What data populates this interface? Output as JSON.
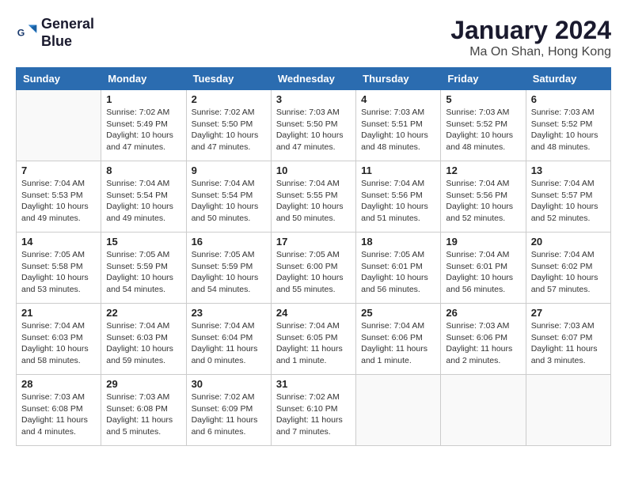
{
  "logo": {
    "line1": "General",
    "line2": "Blue"
  },
  "title": {
    "month_year": "January 2024",
    "location": "Ma On Shan, Hong Kong"
  },
  "weekdays": [
    "Sunday",
    "Monday",
    "Tuesday",
    "Wednesday",
    "Thursday",
    "Friday",
    "Saturday"
  ],
  "weeks": [
    [
      {
        "day": "",
        "info": ""
      },
      {
        "day": "1",
        "info": "Sunrise: 7:02 AM\nSunset: 5:49 PM\nDaylight: 10 hours\nand 47 minutes."
      },
      {
        "day": "2",
        "info": "Sunrise: 7:02 AM\nSunset: 5:50 PM\nDaylight: 10 hours\nand 47 minutes."
      },
      {
        "day": "3",
        "info": "Sunrise: 7:03 AM\nSunset: 5:50 PM\nDaylight: 10 hours\nand 47 minutes."
      },
      {
        "day": "4",
        "info": "Sunrise: 7:03 AM\nSunset: 5:51 PM\nDaylight: 10 hours\nand 48 minutes."
      },
      {
        "day": "5",
        "info": "Sunrise: 7:03 AM\nSunset: 5:52 PM\nDaylight: 10 hours\nand 48 minutes."
      },
      {
        "day": "6",
        "info": "Sunrise: 7:03 AM\nSunset: 5:52 PM\nDaylight: 10 hours\nand 48 minutes."
      }
    ],
    [
      {
        "day": "7",
        "info": "Sunrise: 7:04 AM\nSunset: 5:53 PM\nDaylight: 10 hours\nand 49 minutes."
      },
      {
        "day": "8",
        "info": "Sunrise: 7:04 AM\nSunset: 5:54 PM\nDaylight: 10 hours\nand 49 minutes."
      },
      {
        "day": "9",
        "info": "Sunrise: 7:04 AM\nSunset: 5:54 PM\nDaylight: 10 hours\nand 50 minutes."
      },
      {
        "day": "10",
        "info": "Sunrise: 7:04 AM\nSunset: 5:55 PM\nDaylight: 10 hours\nand 50 minutes."
      },
      {
        "day": "11",
        "info": "Sunrise: 7:04 AM\nSunset: 5:56 PM\nDaylight: 10 hours\nand 51 minutes."
      },
      {
        "day": "12",
        "info": "Sunrise: 7:04 AM\nSunset: 5:56 PM\nDaylight: 10 hours\nand 52 minutes."
      },
      {
        "day": "13",
        "info": "Sunrise: 7:04 AM\nSunset: 5:57 PM\nDaylight: 10 hours\nand 52 minutes."
      }
    ],
    [
      {
        "day": "14",
        "info": "Sunrise: 7:05 AM\nSunset: 5:58 PM\nDaylight: 10 hours\nand 53 minutes."
      },
      {
        "day": "15",
        "info": "Sunrise: 7:05 AM\nSunset: 5:59 PM\nDaylight: 10 hours\nand 54 minutes."
      },
      {
        "day": "16",
        "info": "Sunrise: 7:05 AM\nSunset: 5:59 PM\nDaylight: 10 hours\nand 54 minutes."
      },
      {
        "day": "17",
        "info": "Sunrise: 7:05 AM\nSunset: 6:00 PM\nDaylight: 10 hours\nand 55 minutes."
      },
      {
        "day": "18",
        "info": "Sunrise: 7:05 AM\nSunset: 6:01 PM\nDaylight: 10 hours\nand 56 minutes."
      },
      {
        "day": "19",
        "info": "Sunrise: 7:04 AM\nSunset: 6:01 PM\nDaylight: 10 hours\nand 56 minutes."
      },
      {
        "day": "20",
        "info": "Sunrise: 7:04 AM\nSunset: 6:02 PM\nDaylight: 10 hours\nand 57 minutes."
      }
    ],
    [
      {
        "day": "21",
        "info": "Sunrise: 7:04 AM\nSunset: 6:03 PM\nDaylight: 10 hours\nand 58 minutes."
      },
      {
        "day": "22",
        "info": "Sunrise: 7:04 AM\nSunset: 6:03 PM\nDaylight: 10 hours\nand 59 minutes."
      },
      {
        "day": "23",
        "info": "Sunrise: 7:04 AM\nSunset: 6:04 PM\nDaylight: 11 hours\nand 0 minutes."
      },
      {
        "day": "24",
        "info": "Sunrise: 7:04 AM\nSunset: 6:05 PM\nDaylight: 11 hours\nand 1 minute."
      },
      {
        "day": "25",
        "info": "Sunrise: 7:04 AM\nSunset: 6:06 PM\nDaylight: 11 hours\nand 1 minute."
      },
      {
        "day": "26",
        "info": "Sunrise: 7:03 AM\nSunset: 6:06 PM\nDaylight: 11 hours\nand 2 minutes."
      },
      {
        "day": "27",
        "info": "Sunrise: 7:03 AM\nSunset: 6:07 PM\nDaylight: 11 hours\nand 3 minutes."
      }
    ],
    [
      {
        "day": "28",
        "info": "Sunrise: 7:03 AM\nSunset: 6:08 PM\nDaylight: 11 hours\nand 4 minutes."
      },
      {
        "day": "29",
        "info": "Sunrise: 7:03 AM\nSunset: 6:08 PM\nDaylight: 11 hours\nand 5 minutes."
      },
      {
        "day": "30",
        "info": "Sunrise: 7:02 AM\nSunset: 6:09 PM\nDaylight: 11 hours\nand 6 minutes."
      },
      {
        "day": "31",
        "info": "Sunrise: 7:02 AM\nSunset: 6:10 PM\nDaylight: 11 hours\nand 7 minutes."
      },
      {
        "day": "",
        "info": ""
      },
      {
        "day": "",
        "info": ""
      },
      {
        "day": "",
        "info": ""
      }
    ]
  ]
}
